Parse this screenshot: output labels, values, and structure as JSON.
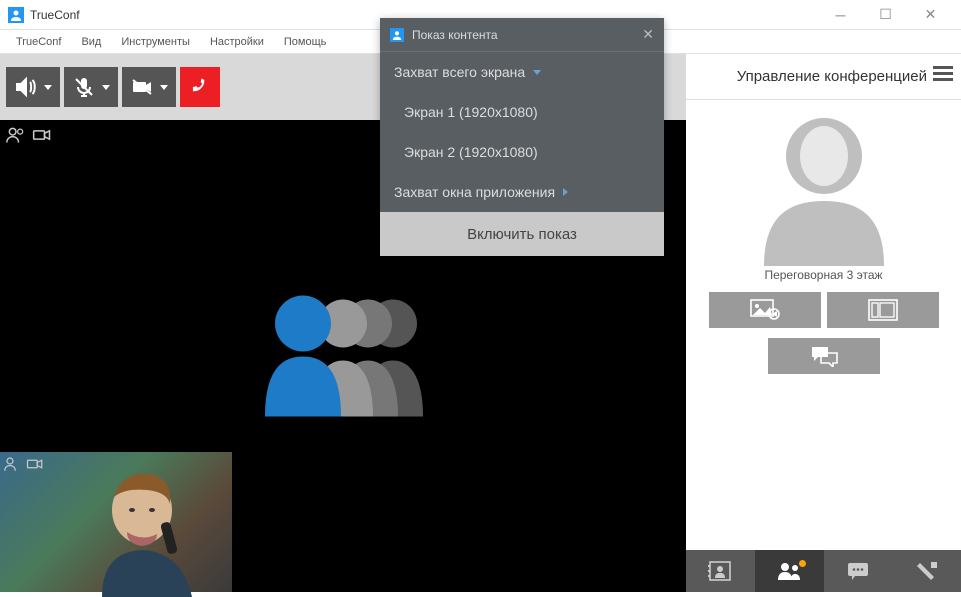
{
  "window": {
    "title": "TrueConf"
  },
  "menubar": {
    "items": [
      "TrueConf",
      "Вид",
      "Инструменты",
      "Настройки",
      "Помощь"
    ]
  },
  "popup": {
    "title": "Показ контента",
    "capture_all": "Захват всего экрана",
    "screens": [
      "Экран 1 (1920x1080)",
      "Экран 2 (1920x1080)"
    ],
    "capture_window": "Захват окна приложения",
    "start_button": "Включить показ"
  },
  "sidebar": {
    "header": "Управление конференцией",
    "participant_name": "Переговорная 3 этаж"
  }
}
